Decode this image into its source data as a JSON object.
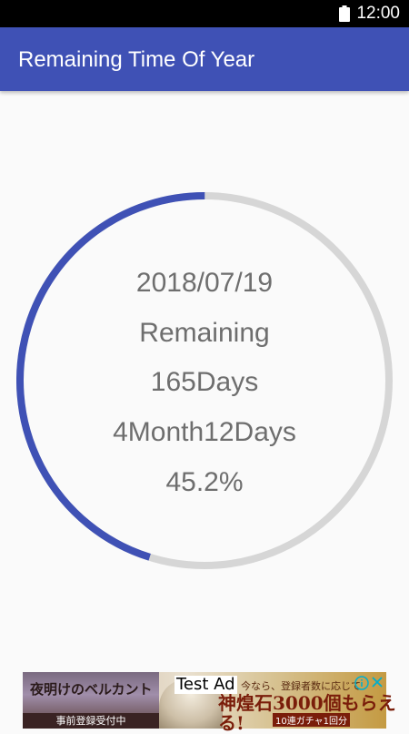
{
  "status_bar": {
    "time": "12:00",
    "icon": "battery-icon"
  },
  "app_bar": {
    "title": "Remaining Time Of Year",
    "color": "#3f51b5"
  },
  "progress": {
    "date": "2018/07/19",
    "label": "Remaining",
    "days": "165Days",
    "months_days": "4Month12Days",
    "percent_text": "45.2%",
    "fraction": 0.452,
    "fill_color": "#3f51b5",
    "track_color": "#d6d6d6"
  },
  "ad": {
    "test_label": "Test Ad",
    "left_title": "夜明けのベルカント",
    "left_sub": "事前登録受付中",
    "right_line1": "今なら、登録者数に応じて",
    "right_line2": "神煌石3000個もらえる!",
    "right_line3": "10連ガチャ1回分",
    "icons": [
      "info-icon",
      "close-icon"
    ]
  }
}
